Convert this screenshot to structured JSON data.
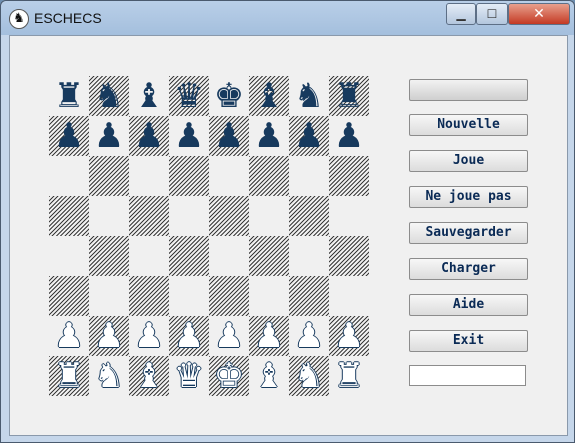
{
  "window": {
    "title": "ESCHECS",
    "icon": "knight-icon"
  },
  "controls": {
    "minimize": "▁",
    "maximize": "☐",
    "close": "✕"
  },
  "board": {
    "rows": [
      [
        "br",
        "bn",
        "bb",
        "bq",
        "bk",
        "bb",
        "bn",
        "br"
      ],
      [
        "bp",
        "bp",
        "bp",
        "bp",
        "bp",
        "bp",
        "bp",
        "bp"
      ],
      [
        "",
        "",
        "",
        "",
        "",
        "",
        "",
        ""
      ],
      [
        "",
        "",
        "",
        "",
        "",
        "",
        "",
        ""
      ],
      [
        "",
        "",
        "",
        "",
        "",
        "",
        "",
        ""
      ],
      [
        "",
        "",
        "",
        "",
        "",
        "",
        "",
        ""
      ],
      [
        "wp",
        "wp",
        "wp",
        "wp",
        "wp",
        "wp",
        "wp",
        "wp"
      ],
      [
        "wr",
        "wn",
        "wb",
        "wq",
        "wk",
        "wb",
        "wn",
        "wr"
      ]
    ]
  },
  "status_top": "",
  "buttons": {
    "new": "Nouvelle",
    "play": "Joue",
    "dont_play": "Ne joue pas",
    "save": "Sauvegarder",
    "load": "Charger",
    "help": "Aide",
    "exit": "Exit"
  },
  "status_bottom": "",
  "colors": {
    "piece_dark": "#173a5e",
    "button_text": "#0a2a55"
  }
}
